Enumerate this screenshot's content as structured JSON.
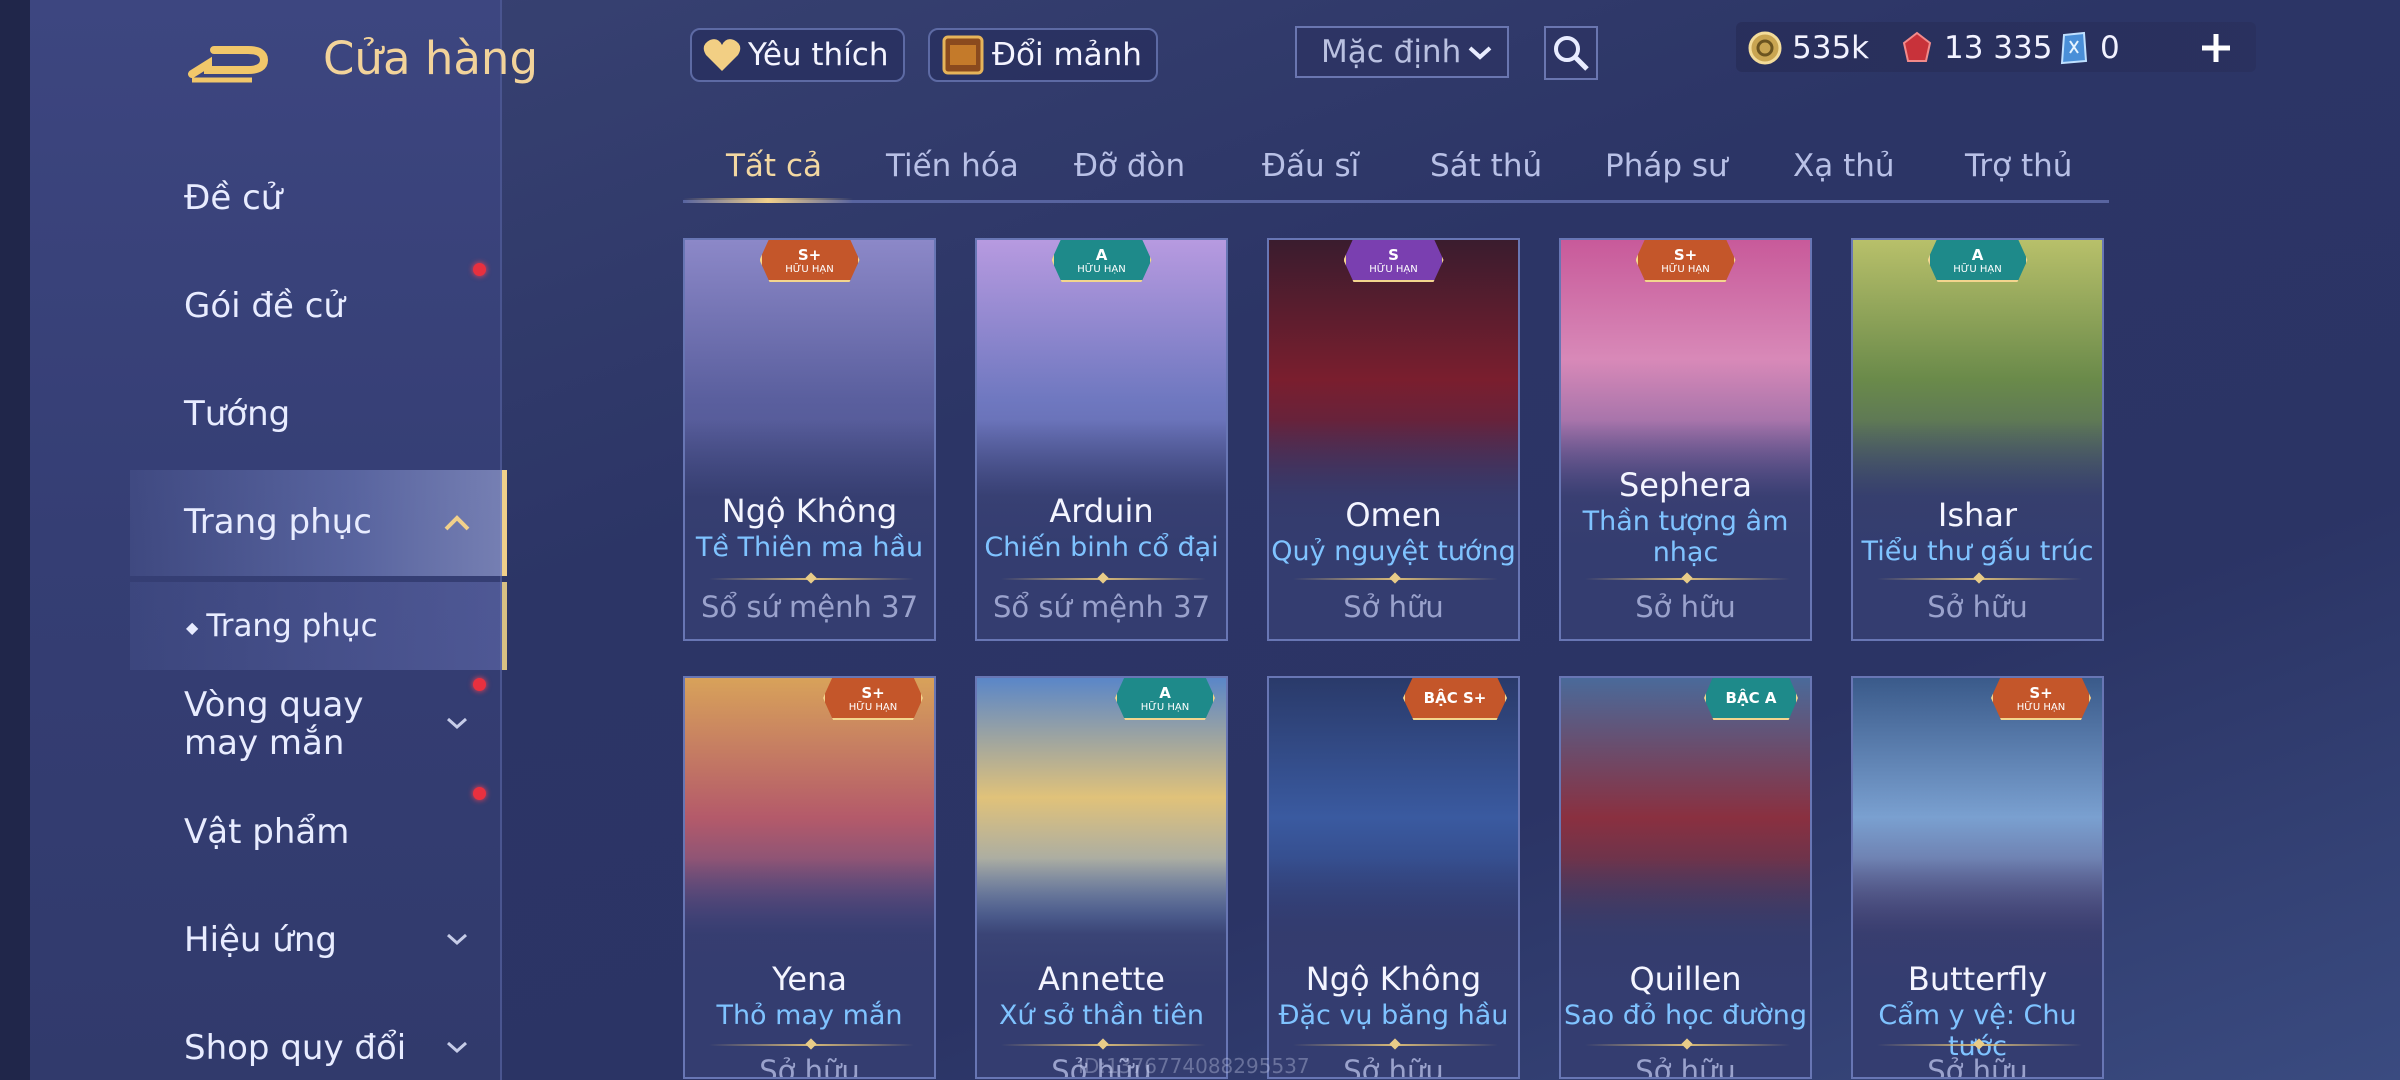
{
  "header": {
    "title": "Cửa hàng",
    "favorites_label": "Yêu thích",
    "exchange_label": "Đổi mảnh",
    "sort_value": "Mặc định"
  },
  "currency": {
    "gold": "535k",
    "vouchers": "13 335",
    "quan_huy": "0"
  },
  "sidebar": {
    "items": [
      {
        "label": "Đề cử"
      },
      {
        "label": "Gói đề cử"
      },
      {
        "label": "Tướng"
      },
      {
        "label": "Trang phục"
      },
      {
        "label": "Trang phục"
      },
      {
        "label": "Vòng quay may mắn"
      },
      {
        "label": "Vật phẩm"
      },
      {
        "label": "Hiệu ứng"
      },
      {
        "label": "Shop quy đổi"
      }
    ]
  },
  "tabs": [
    "Tất cả",
    "Tiến hóa",
    "Đỡ đòn",
    "Đấu sĩ",
    "Sát thủ",
    "Pháp sư",
    "Xạ thủ",
    "Trợ thủ"
  ],
  "cards": [
    {
      "hero": "Ngộ Không",
      "skin": "Tề Thiên ma hầu",
      "status": "Sổ sứ mệnh 37",
      "badge": "S+",
      "badge_sub": "HỮU HẠN"
    },
    {
      "hero": "Arduin",
      "skin": "Chiến binh cổ đại",
      "status": "Sổ sứ mệnh 37",
      "badge": "A",
      "badge_sub": "HỮU HẠN"
    },
    {
      "hero": "Omen",
      "skin": "Quỷ nguyệt tướng",
      "status": "Sở hữu",
      "badge": "S",
      "badge_sub": "HỮU HẠN"
    },
    {
      "hero": "Sephera",
      "skin": "Thần tượng âm nhạc",
      "status": "Sở hữu",
      "badge": "S+",
      "badge_sub": "HỮU HẠN"
    },
    {
      "hero": "Ishar",
      "skin": "Tiểu thư gấu trúc",
      "status": "Sở hữu",
      "badge": "A",
      "badge_sub": "HỮU HẠN"
    },
    {
      "hero": "Yena",
      "skin": "Thỏ may mắn",
      "status": "Sở hữu",
      "badge": "S+",
      "badge_sub": "HỮU HẠN"
    },
    {
      "hero": "Annette",
      "skin": "Xứ sở thần tiên",
      "status": "Sở hữu",
      "badge": "A",
      "badge_sub": "HỮU HẠN"
    },
    {
      "hero": "Ngộ Không",
      "skin": "Đặc vụ băng hầu",
      "status": "Sở hữu",
      "badge": "BẬC S+",
      "badge_sub": ""
    },
    {
      "hero": "Quillen",
      "skin": "Sao đỏ học đường",
      "status": "Sở hữu",
      "badge": "BẬC A",
      "badge_sub": ""
    },
    {
      "hero": "Butterfly",
      "skin": "Cẩm y vệ: Chu tước",
      "status": "Sở hữu",
      "badge": "S+",
      "badge_sub": "HỮU HẠN"
    }
  ],
  "watermark": "ID:1376774088295537",
  "colors": {
    "accent_gold": "#f1d08a",
    "skin_blue": "#7fc3ff",
    "notification_red": "#e8303f",
    "badge_splus": "#c4562a",
    "badge_a": "#1e8a8a",
    "badge_s": "#7a3fb0"
  }
}
